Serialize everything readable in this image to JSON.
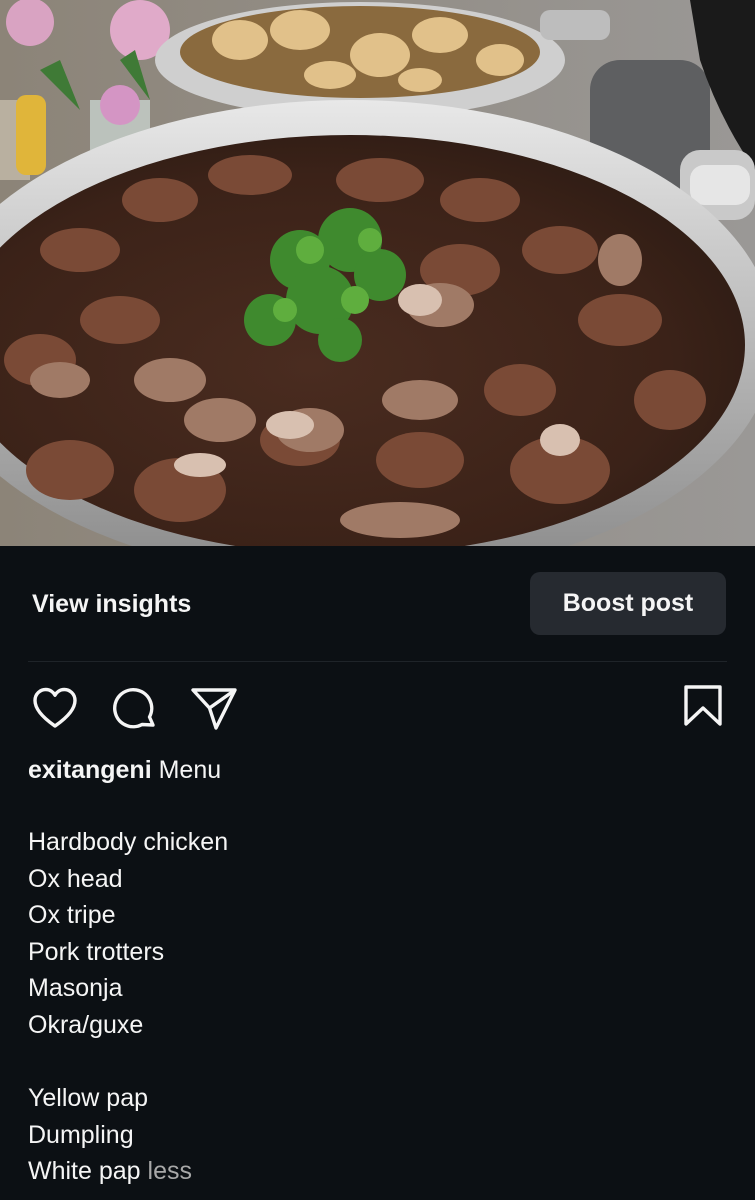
{
  "post": {
    "photo_icon": "food-photo",
    "view_insights_label": "View insights",
    "boost_label": "Boost post"
  },
  "actions": {
    "like_icon": "heart-icon",
    "comment_icon": "comment-icon",
    "share_icon": "paper-plane-icon",
    "save_icon": "bookmark-icon"
  },
  "caption": {
    "username": "exitangeni",
    "title": "Menu",
    "items_group_1": [
      "Hardbody chicken",
      "Ox head",
      "Ox tripe",
      "Pork trotters",
      "Masonja",
      "Okra/guxe"
    ],
    "items_group_2": [
      "Yellow pap",
      "Dumpling",
      "White pap"
    ],
    "less_label": "less"
  },
  "colors": {
    "background": "#0c1014",
    "button": "#262a30",
    "text": "#f5f5f5",
    "muted": "#a8a8a8"
  }
}
